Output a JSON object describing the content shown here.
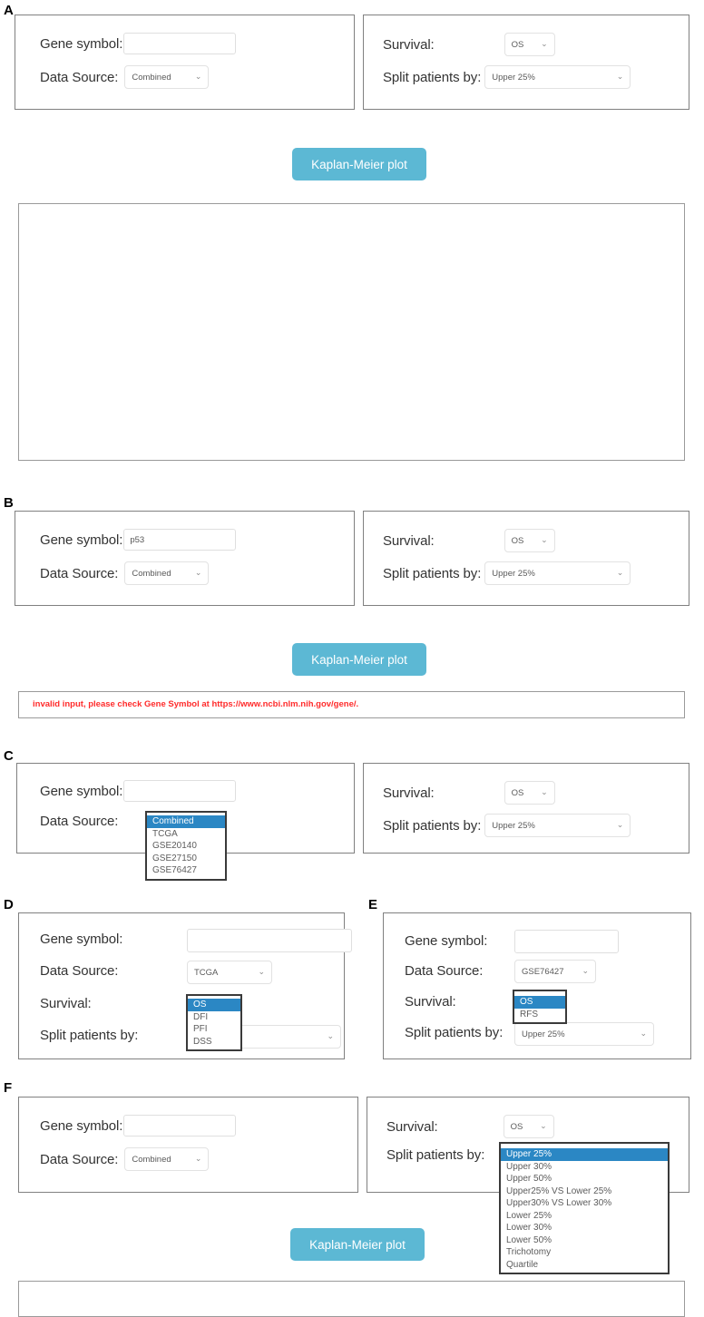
{
  "panels": {
    "a": {
      "letter": "A"
    },
    "b": {
      "letter": "B"
    },
    "c": {
      "letter": "C"
    },
    "d": {
      "letter": "D"
    },
    "e": {
      "letter": "E"
    },
    "f": {
      "letter": "F"
    }
  },
  "labels": {
    "gene_symbol": "Gene symbol:",
    "data_source": "Data Source:",
    "survival": "Survival:",
    "split_patients_by": "Split patients by:"
  },
  "button": {
    "kaplan_meier": "Kaplan-Meier plot",
    "color": "#5cb8d4"
  },
  "colors": {
    "highlight": "#2b87c4",
    "error_text": "#ff2b2b",
    "panel_border": "#808080"
  },
  "icons": {
    "chevron_down": "⌄"
  },
  "values": {
    "gene_empty": "",
    "gene_p53": "p53",
    "gene_placeholder": "",
    "data_source_combined": "Combined",
    "data_source_tcga": "TCGA",
    "data_source_gse76427": "GSE76427",
    "survival_os": "OS",
    "split_upper25": "Upper 25%",
    "split_partial": "%"
  },
  "error": {
    "message": "invalid input, please check Gene Symbol at https://www.ncbi.nlm.nih.gov/gene/."
  },
  "options": {
    "data_source": [
      "Combined",
      "TCGA",
      "GSE20140",
      "GSE27150",
      "GSE76427"
    ],
    "survival_tcga": [
      "OS",
      "DFI",
      "PFI",
      "DSS"
    ],
    "survival_gse": [
      "OS",
      "RFS"
    ],
    "split_patients_by": [
      "Upper 25%",
      "Upper 30%",
      "Upper 50%",
      "Upper25% VS Lower 25%",
      "Upper30% VS Lower 30%",
      "Lower 25%",
      "Lower 30%",
      "Lower 50%",
      "Trichotomy",
      "Quartile"
    ]
  },
  "selected": {
    "data_source_index": 0,
    "survival_tcga_index": 0,
    "survival_gse_index": 0,
    "split_index": 0
  }
}
